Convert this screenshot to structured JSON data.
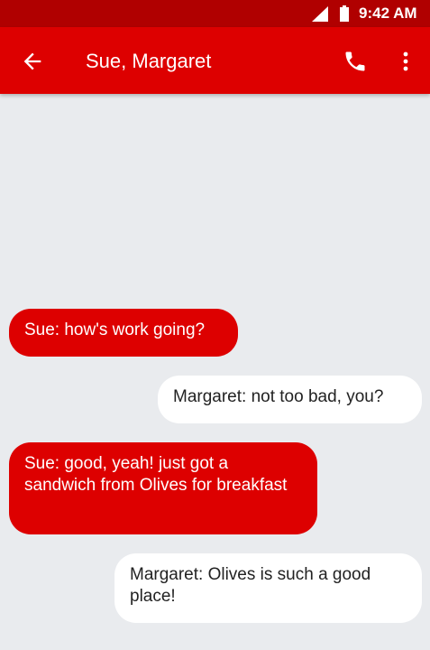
{
  "status_bar": {
    "time": "9:42 AM",
    "icons": [
      "signal-icon",
      "battery-icon"
    ]
  },
  "app_bar": {
    "title": "Sue, Margaret",
    "icons": [
      "back-arrow-icon",
      "phone-icon",
      "more-vert-icon"
    ],
    "color": "#dd0000"
  },
  "messages": [
    {
      "sender": "Sue",
      "direction": "incoming",
      "text": "Sue: how's work going?"
    },
    {
      "sender": "Margaret",
      "direction": "outgoing",
      "text": "Margaret: not too bad, you?"
    },
    {
      "sender": "Sue",
      "direction": "incoming",
      "text": "Sue: good, yeah! just got a sandwich from Olives for breakfast"
    },
    {
      "sender": "Margaret",
      "direction": "outgoing",
      "text": "Margaret: Olives is such a good place!"
    }
  ],
  "colors": {
    "status_bar": "#b00000",
    "incoming_bubble": "#dd0000",
    "outgoing_bubble": "#ffffff",
    "background": "#e9ebee"
  }
}
